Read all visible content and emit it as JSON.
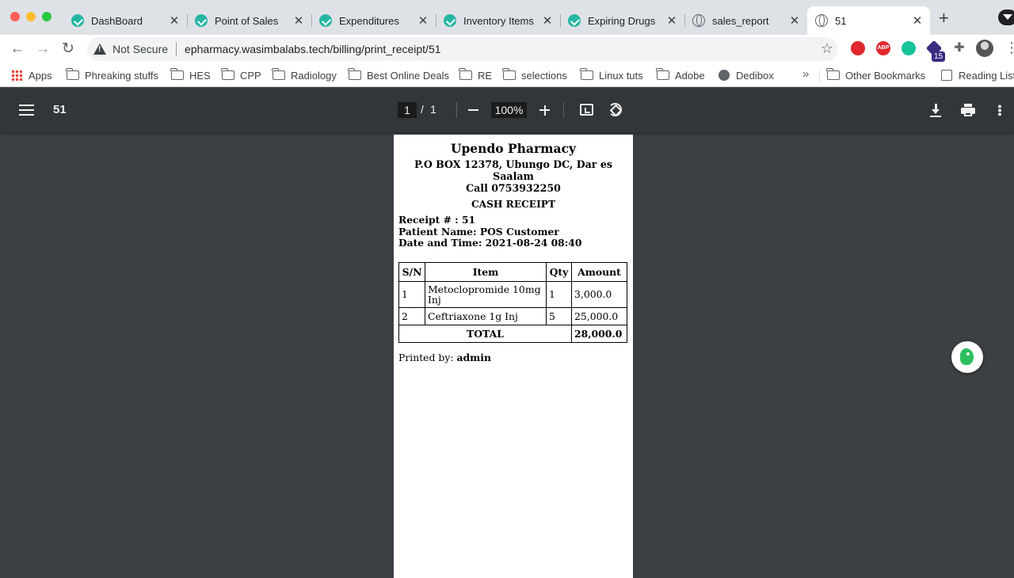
{
  "browser": {
    "tabs": [
      {
        "label": "DashBoard",
        "favicon": "teal-logo-icon"
      },
      {
        "label": "Point of Sales",
        "favicon": "teal-logo-icon"
      },
      {
        "label": "Expenditures",
        "favicon": "teal-logo-icon"
      },
      {
        "label": "Inventory Items",
        "favicon": "teal-logo-icon"
      },
      {
        "label": "Expiring Drugs",
        "favicon": "teal-logo-icon"
      },
      {
        "label": "sales_report",
        "favicon": "globe-icon"
      },
      {
        "label": "51",
        "favicon": "globe-icon",
        "active": true
      }
    ],
    "address": {
      "security_label": "Not Secure",
      "url": "epharmacy.wasimbalabs.tech/billing/print_receipt/51"
    },
    "extensions": {
      "abp_label": "ABP",
      "badge_count": "15"
    },
    "bookmarks": [
      {
        "label": "Apps"
      },
      {
        "label": "Phreaking stuffs"
      },
      {
        "label": "HES"
      },
      {
        "label": "CPP"
      },
      {
        "label": "Radiology"
      },
      {
        "label": "Best Online Deals"
      },
      {
        "label": "RE"
      },
      {
        "label": "selections"
      },
      {
        "label": "Linux tuts"
      },
      {
        "label": "Adobe"
      },
      {
        "label": "Dedibox"
      }
    ],
    "bookmarks_more": "»",
    "other_bookmarks": "Other Bookmarks",
    "reading_list": "Reading List"
  },
  "pdf_viewer": {
    "title": "51",
    "current_page": "1",
    "page_separator": "/",
    "total_pages": "1",
    "zoom": "100%"
  },
  "receipt": {
    "pharmacy_name": "Upendo Pharmacy",
    "address": "P.O BOX 12378, Ubungo DC, Dar es Saalam",
    "phone": "Call 0753932250",
    "title": "CASH RECEIPT",
    "receipt_no": "Receipt # : 51",
    "patient": "Patient Name: POS Customer",
    "datetime": "Date and Time: 2021-08-24 08:40",
    "columns": [
      "S/N",
      "Item",
      "Qty",
      "Amount"
    ],
    "rows": [
      {
        "sn": "1",
        "item": "Metoclopromide 10mg Inj",
        "qty": "1",
        "amount": "3,000.0"
      },
      {
        "sn": "2",
        "item": "Ceftriaxone 1g Inj",
        "qty": "5",
        "amount": "25,000.0"
      }
    ],
    "total_label": "TOTAL",
    "total_value": "28,000.0",
    "printed_by_label": "Printed by:",
    "printed_by": "admin"
  },
  "colors": {
    "pdf_background": "#3c3f43",
    "pdf_toolbar": "#323639",
    "tab_favicon": "#26b6a4",
    "evernote": "#2dbe60"
  }
}
